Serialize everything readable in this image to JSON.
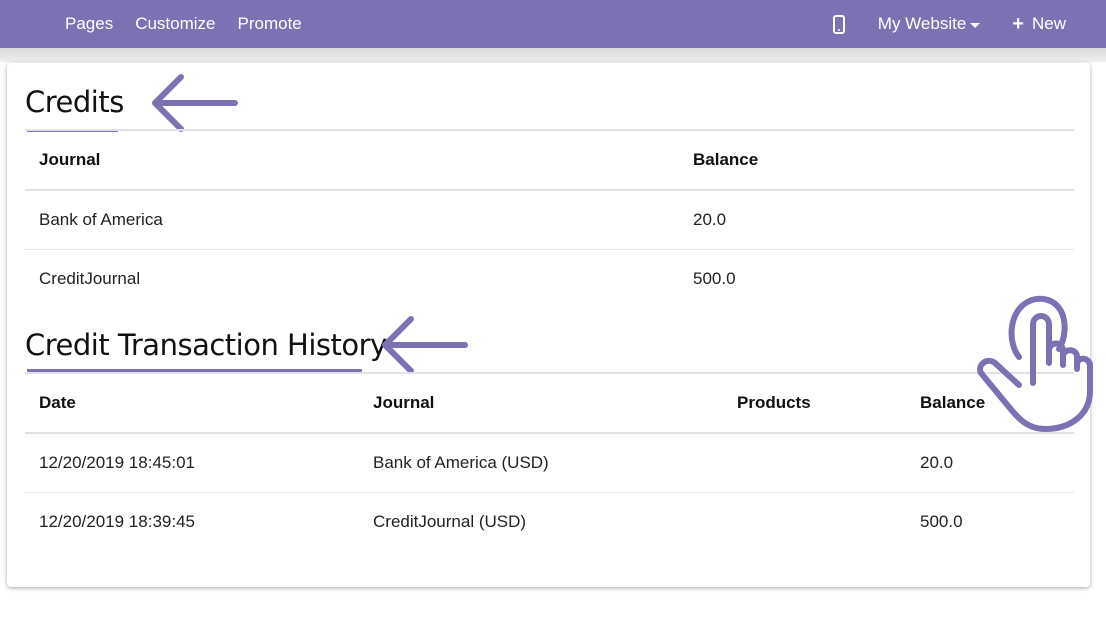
{
  "navbar": {
    "links": [
      "Pages",
      "Customize",
      "Promote"
    ],
    "mobile_icon": "mobile-phone-icon",
    "website_menu": "My Website",
    "new_label": "New"
  },
  "credits": {
    "title": "Credits",
    "columns": [
      "Journal",
      "Balance"
    ],
    "rows": [
      [
        "Bank of America",
        "20.0"
      ],
      [
        "CreditJournal",
        "500.0"
      ]
    ]
  },
  "history": {
    "title": "Credit Transaction History",
    "columns": [
      "Date",
      "Journal",
      "Products",
      "Balance"
    ],
    "rows": [
      [
        "12/20/2019 18:45:01",
        "Bank of America (USD)",
        "",
        "20.0"
      ],
      [
        "12/20/2019 18:39:45",
        "CreditJournal (USD)",
        "",
        "500.0"
      ]
    ]
  },
  "colors": {
    "accent": "#7a72b3"
  },
  "annotations": {
    "arrow_icon": "left-arrow-icon",
    "hand_icon": "pointing-hand-icon"
  }
}
